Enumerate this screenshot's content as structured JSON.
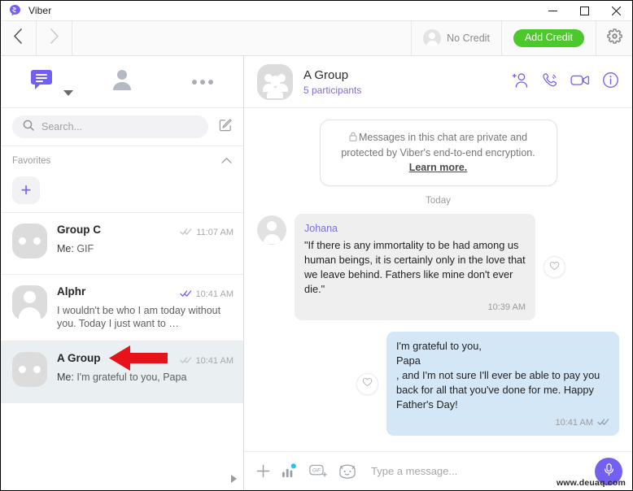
{
  "window": {
    "app_title": "Viber",
    "logo_icon": "viber-logo-icon",
    "minimize_label": "─",
    "maximize_label": "□",
    "close_label": "✕"
  },
  "topbar": {
    "back_icon": "chevron-left-icon",
    "forward_icon": "chevron-right-icon",
    "credit_label": "No Credit",
    "credit_avatar_icon": "user-avatar-icon",
    "add_credit_label": "Add Credit",
    "add_credit_color": "#4cc72c",
    "settings_icon": "gear-icon"
  },
  "sidebar": {
    "tabs": [
      {
        "name": "chats",
        "icon": "chat-bubble-icon",
        "active": true
      },
      {
        "name": "contacts",
        "icon": "person-icon",
        "active": false
      },
      {
        "name": "more",
        "icon": "ellipsis-icon",
        "active": false
      }
    ],
    "search": {
      "placeholder": "Search...",
      "value": "",
      "icon": "search-icon"
    },
    "compose_icon": "compose-icon",
    "favorites": {
      "title": "Favorites",
      "collapse_icon": "chevron-up-icon",
      "add_label": "+"
    },
    "chats": [
      {
        "name": "Group C",
        "avatar": "group",
        "snippet_prefix": "Me: ",
        "snippet": "GIF",
        "time": "11:07 AM",
        "status_icon": "double-check-icon",
        "status_read": false,
        "selected": false
      },
      {
        "name": "Alphr",
        "avatar": "person",
        "snippet_prefix": "",
        "snippet": "I wouldn't be who I am today without you. Today I just want to …",
        "time": "10:41 AM",
        "status_icon": "double-check-icon",
        "status_read": true,
        "selected": false
      },
      {
        "name": "A Group",
        "avatar": "group",
        "snippet_prefix": "Me: ",
        "snippet": "I'm grateful to you, Papa",
        "time": "10:41 AM",
        "status_icon": "double-check-icon",
        "status_read": false,
        "selected": true
      }
    ],
    "scroll_arrow_icon": "triangle-right-icon"
  },
  "conversation": {
    "title": "A Group",
    "subtitle": "5 participants",
    "avatar_icon": "group-avatar-icon",
    "actions": [
      {
        "name": "add-participant",
        "icon": "add-person-icon"
      },
      {
        "name": "voice-call",
        "icon": "phone-icon"
      },
      {
        "name": "video-call",
        "icon": "video-camera-icon"
      },
      {
        "name": "chat-info",
        "icon": "info-icon"
      }
    ],
    "encryption_notice": {
      "lock_icon": "lock-icon",
      "text": "Messages in this chat are private and protected by Viber's end-to-end encryption. ",
      "link_label": "Learn more."
    },
    "day_separator": "Today",
    "messages": [
      {
        "direction": "in",
        "author": "Johana",
        "text": "\"If there is any immortality to be had among us human beings, it is certainly only in the love that we leave behind. Fathers like mine don't ever die.\"",
        "time": "10:39 AM",
        "like_icon": "heart-icon",
        "avatar_icon": "user-avatar-icon"
      },
      {
        "direction": "out",
        "author": "",
        "text": "I'm grateful to you,\nPapa\n, and I'm not sure I'll ever be able to pay you back for all that you've done for me. Happy Father's Day!",
        "time": "10:41 AM",
        "status_icon": "double-check-icon",
        "like_icon": "heart-icon"
      }
    ]
  },
  "composer": {
    "add_icon": "plus-icon",
    "poll_icon": "poll-icon",
    "gif_icon": "gif-icon",
    "sticker_icon": "sticker-icon",
    "placeholder": "Type a message...",
    "value": "",
    "mic_icon": "microphone-icon"
  },
  "annotation": {
    "arrow_icon": "red-arrow-left-icon",
    "arrow_color": "#e8131a"
  },
  "watermark": {
    "text": "www.deuaq.com"
  },
  "theme": {
    "accent_purple": "#7360f2",
    "bubble_in": "#efefef",
    "bubble_out": "#d4e7f7",
    "selected_row": "#eaeff2"
  }
}
